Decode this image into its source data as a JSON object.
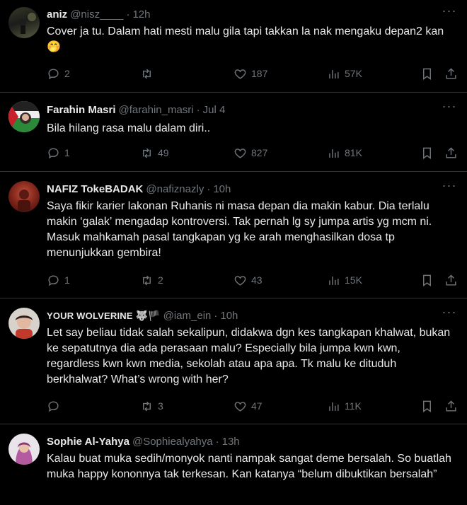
{
  "tweets": [
    {
      "name": "aniz",
      "handle": "@nisz____",
      "time": "12h",
      "text": "Cover ja tu. Dalam hati mesti malu gila tapi takkan la nak mengaku depan2 kan🤭",
      "replies": "2",
      "retweets": "",
      "likes": "187",
      "views": "57K"
    },
    {
      "name": "Farahin Masri",
      "handle": "@farahin_masri",
      "time": "Jul 4",
      "text": "Bila hilang rasa malu dalam diri..",
      "replies": "1",
      "retweets": "49",
      "likes": "827",
      "views": "81K"
    },
    {
      "name": "NAFIZ TokeBADAK",
      "handle": "@nafiznazly",
      "time": "10h",
      "text": "Saya fikir karier lakonan Ruhanis ni masa depan dia makin kabur. Dia terlalu makin ‘galak’ mengadap kontroversi. Tak pernah lg sy jumpa artis yg mcm ni. Masuk mahkamah pasal tangkapan yg ke arah menghasilkan dosa tp menunjukkan gembira!",
      "replies": "1",
      "retweets": "2",
      "likes": "43",
      "views": "15K"
    },
    {
      "name": "YOUR WOLVERINE",
      "flags": "🐺🏴",
      "handle": "@iam_ein",
      "time": "10h",
      "text": "Let say beliau tidak salah sekalipun, didakwa dgn kes tangkapan khalwat, bukan ke sepatutnya dia ada perasaan malu? Especially bila jumpa kwn kwn, regardless kwn kwn media, sekolah atau apa apa. Tk malu ke dituduh berkhalwat? What’s wrong with her?",
      "replies": "",
      "retweets": "3",
      "likes": "47",
      "views": "11K"
    },
    {
      "name": "Sophie Al-Yahya",
      "handle": "@Sophiealyahya",
      "time": "13h",
      "text": "Kalau buat muka sedih/monyok nanti nampak sangat deme bersalah. So buatlah muka happy kononnya tak terkesan. Kan katanya “belum dibuktikan bersalah”"
    }
  ],
  "separator": "·",
  "more_glyph": "···",
  "colors": {
    "background": "#000000",
    "text": "#e7e9ea",
    "muted": "#71767b",
    "divider": "#2f3336"
  },
  "icons": [
    "reply-icon",
    "retweet-icon",
    "like-icon",
    "views-icon",
    "bookmark-icon",
    "share-icon",
    "more-icon"
  ]
}
